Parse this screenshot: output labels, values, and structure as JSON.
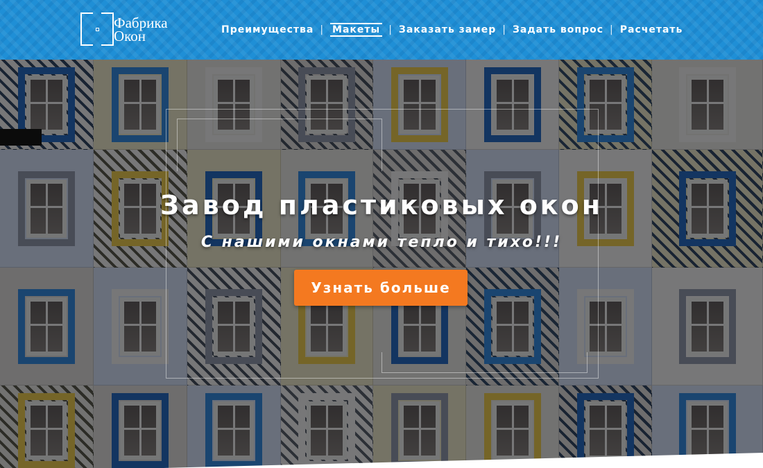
{
  "header": {
    "logo": {
      "line1": "Фабрика",
      "line2": "Окон"
    },
    "nav": [
      {
        "label": "Преимущества",
        "active": false
      },
      {
        "label": "Макеты",
        "active": true
      },
      {
        "label": "Заказать замер",
        "active": false
      },
      {
        "label": "Задать вопрос",
        "active": false
      },
      {
        "label": "Расчетать",
        "active": false
      }
    ],
    "separator": "|"
  },
  "hero": {
    "title": "Завод пластиковых окон",
    "subtitle": "С нашими окнами тепло и тихо!!!",
    "cta_label": "Узнать больше"
  },
  "colors": {
    "header_bg": "#1f8fd6",
    "cta_bg": "#f47920",
    "text": "#ffffff",
    "trim_blue": "#1c5fb0",
    "trim_yellow": "#e8c23a",
    "wall_white": "#ece8df"
  }
}
